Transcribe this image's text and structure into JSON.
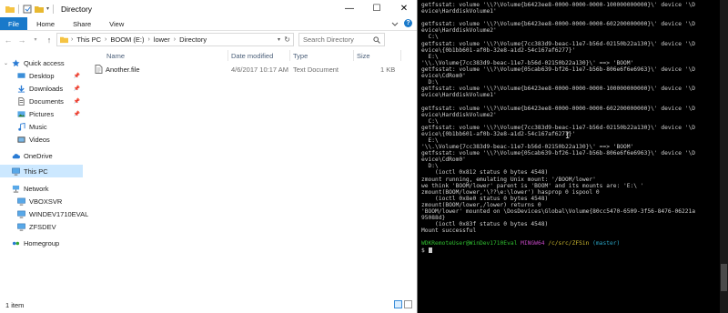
{
  "explorer": {
    "title": "Directory",
    "ribbon_tabs": [
      "File",
      "Home",
      "Share",
      "View"
    ],
    "breadcrumb": [
      "This PC",
      "BOOM (E:)",
      "lower",
      "Directory"
    ],
    "search_placeholder": "Search Directory",
    "nav": {
      "quick_access": "Quick access",
      "quick_items": [
        "Desktop",
        "Downloads",
        "Documents",
        "Pictures",
        "Music",
        "Videos"
      ],
      "onedrive": "OneDrive",
      "this_pc": "This PC",
      "network": "Network",
      "network_items": [
        "VBOXSVR",
        "WINDEV1710EVAL",
        "ZFSDEV"
      ],
      "homegroup": "Homegroup"
    },
    "columns": [
      "Name",
      "Date modified",
      "Type",
      "Size"
    ],
    "files": [
      {
        "name": "Another.file",
        "date": "4/6/2017 10:17 AM",
        "type": "Text Document",
        "size": "1 KB"
      }
    ],
    "status": "1 item",
    "colors": {
      "accent": "#1979ca",
      "selection": "#cce8ff",
      "folder": "#f5c342"
    }
  },
  "terminal": {
    "lines": [
      "getfsstat: volume '\\\\?\\Volume{b6423ee8-0000-0000-0000-100000000000}\\' device '\\D",
      "evice\\HarddiskVolume1'",
      "",
      "getfsstat: volume '\\\\?\\Volume{b6423ee8-0000-0000-0000-602200000000}\\' device '\\D",
      "evice\\HarddiskVolume2'",
      "  C:\\",
      "getfsstat: volume '\\\\?\\Volume{7cc383d9-beac-11e7-b56d-02150b22a130}\\' device '\\D",
      "evice\\{0b1bb601-af0b-32e8-a1d2-54c167af6277}'",
      "  E:\\",
      "'\\\\.\\Volume{7cc383d9-beac-11e7-b56d-02150b22a130}\\' ==> 'BOOM'",
      "getfsstat: volume '\\\\?\\Volume{05cab639-bf26-11e7-b56b-806e6f6e6963}\\' device '\\D",
      "evice\\CdRom0'",
      "  D:\\",
      "getfsstat: volume '\\\\?\\Volume{b6423ee8-0000-0000-0000-100000000000}\\' device '\\D",
      "evice\\HarddiskVolume1'",
      "",
      "getfsstat: volume '\\\\?\\Volume{b6423ee8-0000-0000-0000-602200000000}\\' device '\\D",
      "evice\\HarddiskVolume2'",
      "  C:\\",
      "getfsstat: volume '\\\\?\\Volume{7cc383d9-beac-11e7-b56d-02150b22a130}\\' device '\\D",
      "evice\\{0b1bb601-af0b-32e8-a1d2-54c167af6277}'",
      "  E:\\",
      "'\\\\.\\Volume{7cc383d9-beac-11e7-b56d-02150b22a130}\\' ==> 'BOOM'",
      "getfsstat: volume '\\\\?\\Volume{05cab639-bf26-11e7-b56b-806e6f6e6963}\\' device '\\D",
      "evice\\CdRom0'",
      "  D:\\",
      "    (ioctl 0x812 status 0 bytes 4548)",
      "zmount running, emulating Unix mount: '/BOOM/lower'",
      "we think 'BOOM/lower' parent is 'BOOM' and its mounts are: 'E:\\ '",
      "zmount(BOOM/lower,'\\??\\e:\\lower') hasprop 0 ispool 0",
      "    (ioctl 0x8e0 status 0 bytes 4548)",
      "zmount(BOOM/lower,/lower) returns 0",
      "'BOOM/lower' mounted on \\DosDevices\\Global\\Volume{80cc5470-6509-3f56-8476-06221a",
      "95088d}",
      "    (ioctl 0x83f status 0 bytes 4548)",
      "Mount successful",
      ""
    ],
    "prompt": {
      "user": "WDKRemoteUser@WinDev1710Eval",
      "system": "MINGW64",
      "path": "/c/src/ZFSin",
      "git": "(master)",
      "symbol": "$"
    },
    "colors": {
      "user": "#2fbd2f",
      "system": "#c247c2",
      "path": "#c8b42d",
      "git": "#2aa3c3",
      "text": "#cfcfcf"
    }
  }
}
